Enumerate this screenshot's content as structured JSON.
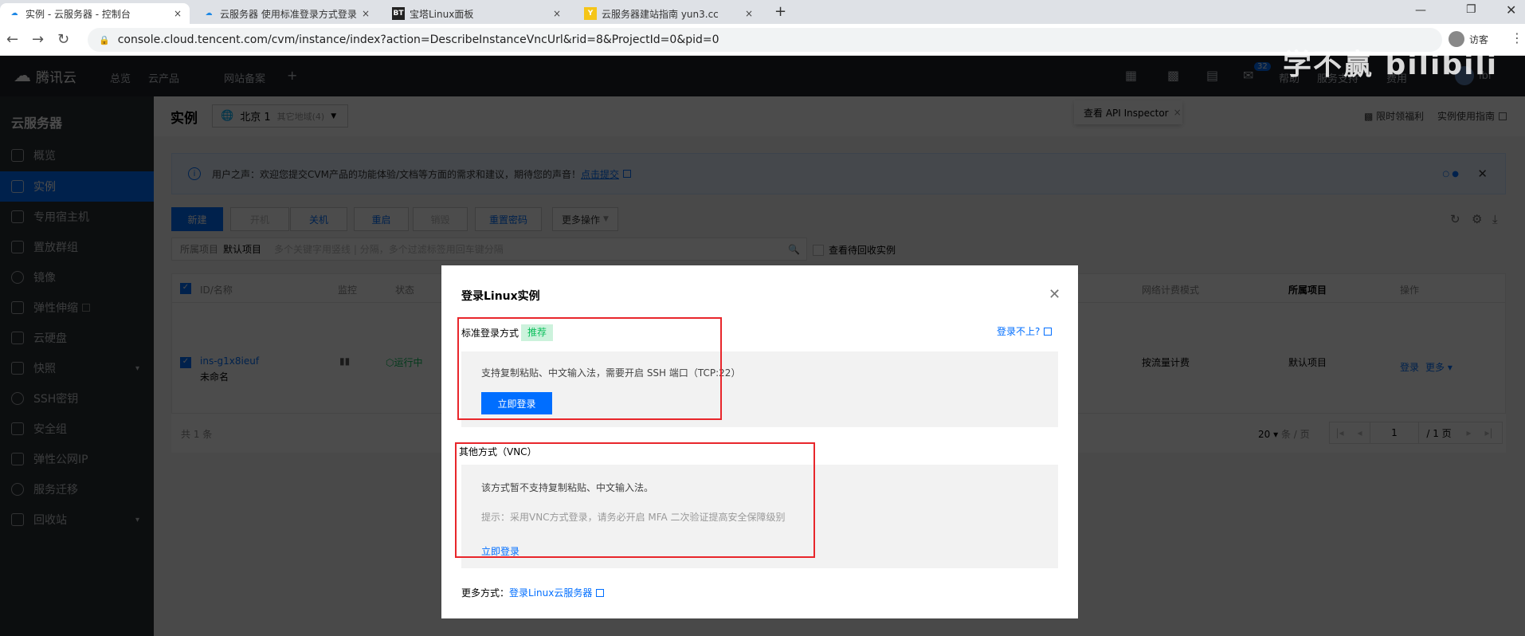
{
  "browser": {
    "tabs": [
      {
        "title": "实例 - 云服务器 - 控制台",
        "icon": "cloud",
        "active": true
      },
      {
        "title": "云服务器 使用标准登录方式登录",
        "icon": "cloud",
        "active": false
      },
      {
        "title": "宝塔Linux面板",
        "icon": "BT",
        "active": false
      },
      {
        "title": "云服务器建站指南 yun3.cc",
        "icon": "Y",
        "active": false
      }
    ],
    "close": "×",
    "new_tab": "+",
    "url": "console.cloud.tencent.com/cvm/instance/index?action=DescribeInstanceVncUrl&rid=8&ProjectId=0&pid=0",
    "profile": "访客",
    "watermark": "学不赢 bilibili"
  },
  "topnav": {
    "logo": "腾讯云",
    "items": [
      "总览",
      "云产品",
      "网站备案",
      "+"
    ],
    "badge": "32",
    "right": [
      "帮助",
      "服务支持",
      "费用"
    ],
    "user": "lbi"
  },
  "sidebar": {
    "title": "云服务器",
    "items": [
      "概览",
      "实例",
      "专用宿主机",
      "置放群组",
      "镜像",
      "弹性伸缩",
      "云硬盘",
      "快照",
      "SSH密钥",
      "安全组",
      "弹性公网IP",
      "服务迁移",
      "回收站"
    ],
    "active": 1
  },
  "header": {
    "title": "实例",
    "region": "北京 1",
    "other_region": "其它地域(4)",
    "tooltip": "查看 API Inspector",
    "links": [
      "限时领福利",
      "实例使用指南"
    ]
  },
  "banner": {
    "text": "用户之声：欢迎您提交CVM产品的功能体验/文档等方面的需求和建议，期待您的声音！",
    "link": "点击提交"
  },
  "toolbar": {
    "buttons": [
      "新建",
      "开机",
      "关机",
      "重启",
      "销毁",
      "重置密码",
      "更多操作"
    ]
  },
  "filter": {
    "project_label": "所属项目",
    "project": "默认项目",
    "placeholder": "多个关键字用竖线 | 分隔，多个过滤标签用回车键分隔",
    "recycle": "查看待回收实例"
  },
  "table": {
    "headers": [
      "ID/名称",
      "监控",
      "状态",
      "网络计费模式",
      "所属项目",
      "操作"
    ],
    "rows": [
      {
        "id": "ins-g1x8ieuf",
        "name": "未命名",
        "status": "运行中",
        "billing": "按流量计费",
        "project": "默认项目",
        "actions": [
          "登录",
          "更多"
        ]
      }
    ],
    "total": "共 1 条",
    "page_size": "20",
    "per_page": "条 / 页",
    "page": "1",
    "pages": "/ 1 页"
  },
  "modal": {
    "title": "登录Linux实例",
    "standard": {
      "label": "标准登录方式",
      "tag": "推荐",
      "help": "登录不上?",
      "desc": "支持复制粘贴、中文输入法，需要开启 SSH 端口（TCP:22）",
      "button": "立即登录"
    },
    "vnc": {
      "label": "其他方式（VNC）",
      "desc": "该方式暂不支持复制粘贴、中文输入法。",
      "hint": "提示：采用VNC方式登录，请务必开启 MFA 二次验证提高安全保障级别",
      "link": "立即登录"
    },
    "more_label": "更多方式：",
    "more_link": "登录Linux云服务器"
  }
}
